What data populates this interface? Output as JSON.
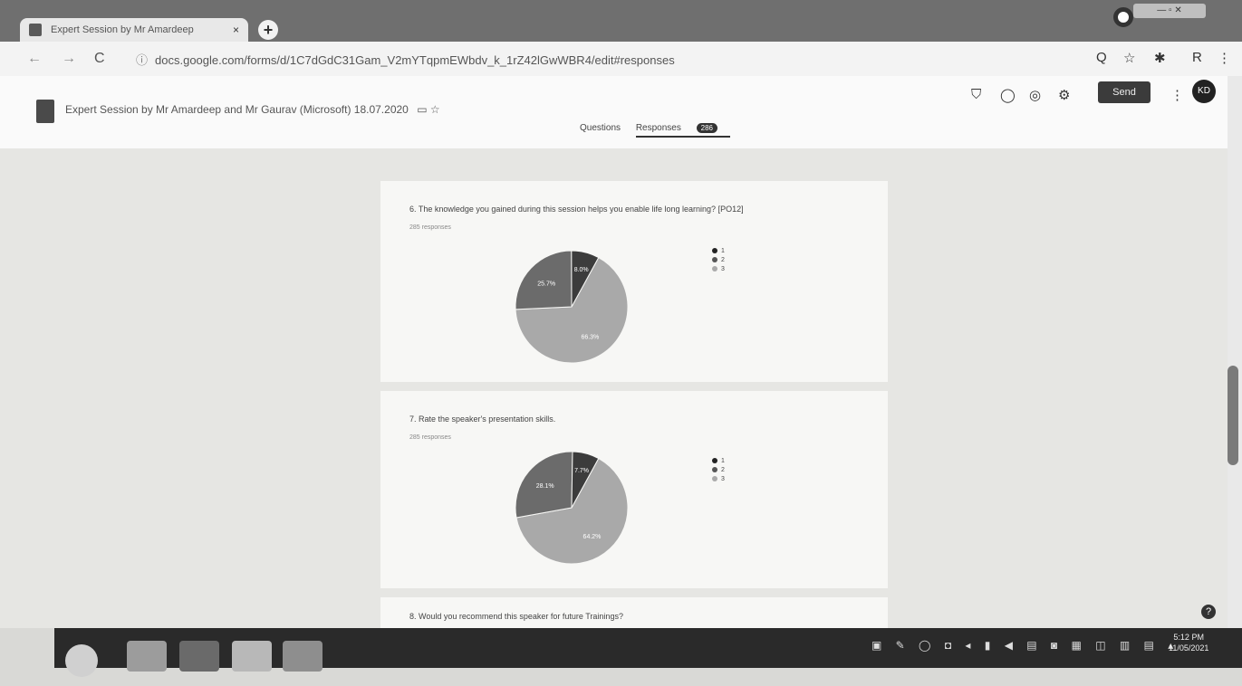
{
  "browser": {
    "tab_title": "Expert Session by Mr Amardeep",
    "tab_close": "×",
    "new_tab": "+",
    "url": "docs.google.com/forms/d/1C7dGdC31Gam_V2mYTqpmEWbdv_k_1rZ42lGwWBR4/edit#responses",
    "lock_icon": "ⓘ",
    "back": "←",
    "forward": "→",
    "reload": "C",
    "toolbar_icons": [
      "Q",
      "☆",
      "✱",
      "R",
      "⋮"
    ],
    "window_controls": "— ▫ ✕"
  },
  "forms_header": {
    "doc_title": "Expert Session by Mr Amardeep and Mr Gaurav (Microsoft) 18.07.2020",
    "title_icons": "▭ ☆",
    "header_icons": [
      "⛉",
      "◯",
      "◎",
      "⚙"
    ],
    "send_label": "Send",
    "more": "⋮",
    "avatar": "KD",
    "tab_questions": "Questions",
    "tab_responses": "Responses",
    "responses_count": "286"
  },
  "questions": [
    {
      "text": "6. The knowledge you gained during this session helps you enable life long learning? [PO12]",
      "responses": "285 responses",
      "legend": [
        "1",
        "2",
        "3"
      ],
      "slice_labels": [
        "66.3%",
        "25.7%",
        "8.0%"
      ],
      "colors": [
        "#a9a9a9",
        "#6b6b6b",
        "#3c3c3c"
      ]
    },
    {
      "text": "7. Rate the speaker's presentation skills.",
      "responses": "285 responses",
      "legend": [
        "1",
        "2",
        "3"
      ],
      "slice_labels": [
        "64.2%",
        "28.1%",
        "7.7%"
      ],
      "colors": [
        "#a9a9a9",
        "#6b6b6b",
        "#3c3c3c"
      ]
    },
    {
      "text": "8. Would you recommend this speaker for future Trainings?"
    }
  ],
  "chart_data": [
    {
      "type": "pie",
      "categories": [
        "3",
        "2",
        "1"
      ],
      "values": [
        66.3,
        25.7,
        8.0
      ]
    },
    {
      "type": "pie",
      "categories": [
        "3",
        "2",
        "1"
      ],
      "values": [
        64.2,
        28.1,
        7.7
      ]
    }
  ],
  "taskbar": {
    "time": "5:12 PM",
    "date": "11/05/2021",
    "tray": "▣ ✎ ◯ ◘ ◂ ▮ ◀ ▤ ◙ ▦ ◫ ▥ ▤ ▴"
  },
  "help": "?"
}
